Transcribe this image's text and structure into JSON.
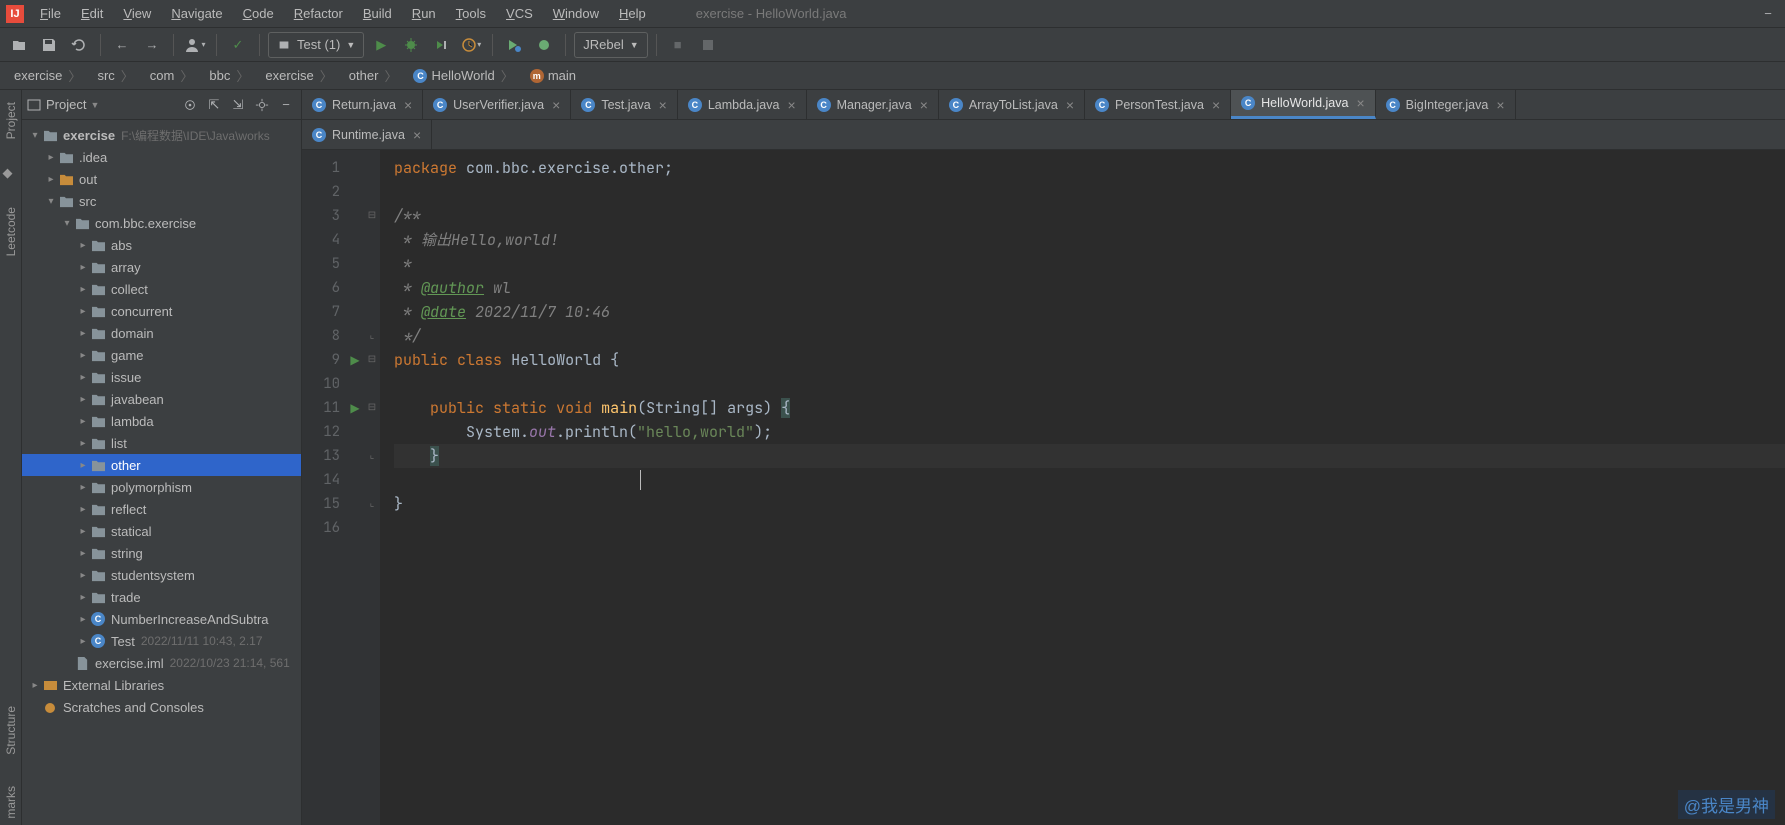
{
  "window": {
    "title": "exercise - HelloWorld.java"
  },
  "menu": [
    "File",
    "Edit",
    "View",
    "Navigate",
    "Code",
    "Refactor",
    "Build",
    "Run",
    "Tools",
    "VCS",
    "Window",
    "Help"
  ],
  "toolbar": {
    "run_config": "Test (1)",
    "jrebel": "JRebel"
  },
  "breadcrumbs": [
    "exercise",
    "src",
    "com",
    "bbc",
    "exercise",
    "other",
    "HelloWorld",
    "main"
  ],
  "project_panel": {
    "title": "Project",
    "root": {
      "name": "exercise",
      "path": "F:\\编程数据\\IDE\\Java\\works"
    },
    "top_children": [
      {
        "name": ".idea",
        "kind": "gray"
      },
      {
        "name": "out",
        "kind": "orange"
      }
    ],
    "src_pkg": "com.bbc.exercise",
    "packages": [
      "abs",
      "array",
      "collect",
      "concurrent",
      "domain",
      "game",
      "issue",
      "javabean",
      "lambda",
      "list",
      "other",
      "polymorphism",
      "reflect",
      "statical",
      "string",
      "studentsystem",
      "trade"
    ],
    "selected_package": "other",
    "classes": [
      {
        "name": "NumberIncreaseAndSubtra",
        "meta": ""
      },
      {
        "name": "Test",
        "meta": "2022/11/11 10:43, 2.17"
      }
    ],
    "files": [
      {
        "name": "exercise.iml",
        "meta": "2022/10/23 21:14, 561"
      }
    ],
    "external": "External Libraries",
    "scratches": "Scratches and Consoles",
    "src_label": "src"
  },
  "tool_strip": {
    "project": "Project",
    "leetcode": "Leetcode",
    "structure": "Structure",
    "bookmarks": "marks"
  },
  "tabs_row1": [
    "Return.java",
    "UserVerifier.java",
    "Test.java",
    "Lambda.java",
    "Manager.java",
    "ArrayToList.java",
    "PersonTest.java",
    "HelloWorld.java",
    "BigInteger.java"
  ],
  "tabs_row1_active": "HelloWorld.java",
  "tabs_row2": [
    "Runtime.java"
  ],
  "code": {
    "lines": [
      {
        "n": 1,
        "html": "<span class='kw'>package</span> com.bbc.exercise.other;"
      },
      {
        "n": 2,
        "html": ""
      },
      {
        "n": 3,
        "html": "<span class='cmt'>/**</span>"
      },
      {
        "n": 4,
        "html": "<span class='cmt'> * 输出Hello,world!</span>"
      },
      {
        "n": 5,
        "html": "<span class='cmt'> *</span>"
      },
      {
        "n": 6,
        "html": "<span class='cmt'> * <span class='doc-tag'>@author</span> wl</span>"
      },
      {
        "n": 7,
        "html": "<span class='cmt'> * <span class='doc-tag'>@date</span> 2022/11/7 10:46</span>"
      },
      {
        "n": 8,
        "html": "<span class='cmt'> */</span>"
      },
      {
        "n": 9,
        "html": "<span class='kw'>public</span> <span class='kw'>class</span> <span class='cls'>HelloWorld</span> {",
        "run": true
      },
      {
        "n": 10,
        "html": ""
      },
      {
        "n": 11,
        "html": "    <span class='kw'>public</span> <span class='kw'>static</span> <span class='kw'>void</span> <span class='mtd'>main</span>(String[] args) <span class='brace-hl'>{</span>",
        "run": true
      },
      {
        "n": 12,
        "html": "        System.<span class='fld'>out</span>.println(<span class='str'>\"hello,world\"</span>);"
      },
      {
        "n": 13,
        "html": "    <span class='brace-hl'>}</span>",
        "current": true
      },
      {
        "n": 14,
        "html": ""
      },
      {
        "n": 15,
        "html": "}"
      },
      {
        "n": 16,
        "html": ""
      }
    ]
  },
  "watermark": "@我是男神"
}
